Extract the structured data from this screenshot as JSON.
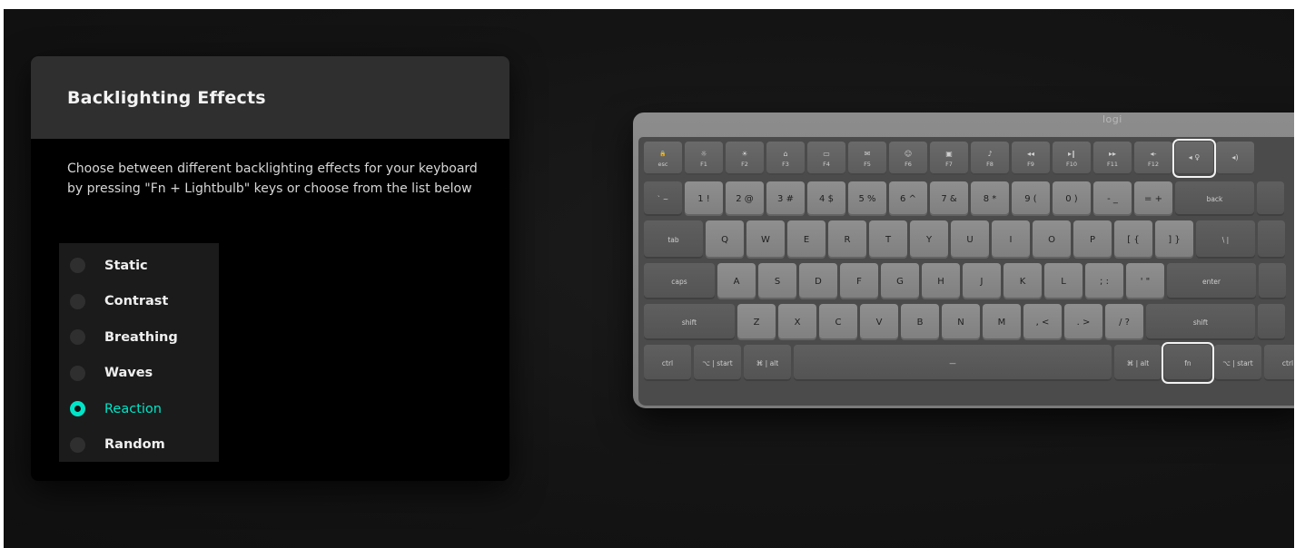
{
  "panel": {
    "title": "Backlighting Effects",
    "description": "Choose between different backlighting effects for your keyboard by pressing \"Fn + Lightbulb\" keys or choose from the list below",
    "selected": "Reaction",
    "options": [
      {
        "label": "Static",
        "selected": false
      },
      {
        "label": "Contrast",
        "selected": false
      },
      {
        "label": "Breathing",
        "selected": false
      },
      {
        "label": "Waves",
        "selected": false
      },
      {
        "label": "Reaction",
        "selected": true
      },
      {
        "label": "Random",
        "selected": false
      }
    ],
    "accent_color": "#00e5c8"
  },
  "keyboard": {
    "brand": "logi",
    "highlighted_keys": [
      "backlight",
      "fn"
    ],
    "rows": [
      [
        {
          "label": "esc",
          "icon": "lock-icon",
          "type": "fn",
          "name": "key-esc"
        },
        {
          "label": "F1",
          "icon": "☼",
          "type": "fn",
          "name": "key-f1"
        },
        {
          "label": "F2",
          "icon": "☀",
          "type": "fn",
          "name": "key-f2"
        },
        {
          "label": "F3",
          "icon": "⌂",
          "type": "fn",
          "name": "key-f3"
        },
        {
          "label": "F4",
          "icon": "▭",
          "type": "fn",
          "name": "key-f4"
        },
        {
          "label": "F5",
          "icon": "✉",
          "type": "fn",
          "name": "key-f5"
        },
        {
          "label": "F6",
          "icon": "☺",
          "type": "fn",
          "name": "key-f6"
        },
        {
          "label": "F7",
          "icon": "▣",
          "type": "fn",
          "name": "key-f7"
        },
        {
          "label": "F8",
          "icon": "♪",
          "type": "fn",
          "name": "key-f8"
        },
        {
          "label": "F9",
          "icon": "◂◂",
          "type": "fn",
          "name": "key-f9"
        },
        {
          "label": "F10",
          "icon": "▸‖",
          "type": "fn",
          "name": "key-f10"
        },
        {
          "label": "F11",
          "icon": "▸▸",
          "type": "fn",
          "name": "key-f11"
        },
        {
          "label": "F12",
          "icon": "◂-",
          "type": "fn",
          "name": "key-f12"
        },
        {
          "label": "",
          "icon": "◂ ♀",
          "type": "fn",
          "name": "key-backlight",
          "selected": true
        },
        {
          "label": "",
          "icon": "◂)",
          "type": "fn",
          "name": "key-volume-up"
        }
      ],
      [
        {
          "label": "` ~",
          "type": "dark",
          "name": "key-backtick"
        },
        {
          "label": "1 !",
          "type": "alpha",
          "name": "key-1"
        },
        {
          "label": "2 @",
          "type": "alpha",
          "name": "key-2"
        },
        {
          "label": "3 #",
          "type": "alpha",
          "name": "key-3"
        },
        {
          "label": "4 $",
          "type": "alpha",
          "name": "key-4"
        },
        {
          "label": "5 %",
          "type": "alpha",
          "name": "key-5"
        },
        {
          "label": "6 ^",
          "type": "alpha",
          "name": "key-6"
        },
        {
          "label": "7 &",
          "type": "alpha",
          "name": "key-7"
        },
        {
          "label": "8 *",
          "type": "alpha",
          "name": "key-8"
        },
        {
          "label": "9 (",
          "type": "alpha",
          "name": "key-9"
        },
        {
          "label": "0 )",
          "type": "alpha",
          "name": "key-0"
        },
        {
          "label": "- _",
          "type": "alpha",
          "name": "key-minus"
        },
        {
          "label": "= +",
          "type": "alpha",
          "name": "key-equals"
        },
        {
          "label": "back",
          "type": "dark",
          "name": "key-backspace"
        },
        {
          "label": "",
          "type": "dark",
          "name": "key-edge"
        }
      ],
      [
        {
          "label": "tab",
          "type": "dark",
          "name": "key-tab"
        },
        {
          "label": "Q",
          "type": "alpha",
          "name": "key-q"
        },
        {
          "label": "W",
          "type": "alpha",
          "name": "key-w"
        },
        {
          "label": "E",
          "type": "alpha",
          "name": "key-e"
        },
        {
          "label": "R",
          "type": "alpha",
          "name": "key-r"
        },
        {
          "label": "T",
          "type": "alpha",
          "name": "key-t"
        },
        {
          "label": "Y",
          "type": "alpha",
          "name": "key-y"
        },
        {
          "label": "U",
          "type": "alpha",
          "name": "key-u"
        },
        {
          "label": "I",
          "type": "alpha",
          "name": "key-i"
        },
        {
          "label": "O",
          "type": "alpha",
          "name": "key-o"
        },
        {
          "label": "P",
          "type": "alpha",
          "name": "key-p"
        },
        {
          "label": "[ {",
          "type": "alpha",
          "name": "key-lbracket"
        },
        {
          "label": "] }",
          "type": "alpha",
          "name": "key-rbracket"
        },
        {
          "label": "\\ |",
          "type": "dark",
          "name": "key-backslash"
        },
        {
          "label": "",
          "type": "dark",
          "name": "key-edge"
        }
      ],
      [
        {
          "label": "caps",
          "type": "dark",
          "name": "key-caps"
        },
        {
          "label": "A",
          "type": "alpha",
          "name": "key-a"
        },
        {
          "label": "S",
          "type": "alpha",
          "name": "key-s"
        },
        {
          "label": "D",
          "type": "alpha",
          "name": "key-d"
        },
        {
          "label": "F",
          "type": "alpha",
          "name": "key-f"
        },
        {
          "label": "G",
          "type": "alpha",
          "name": "key-g"
        },
        {
          "label": "H",
          "type": "alpha",
          "name": "key-h"
        },
        {
          "label": "J",
          "type": "alpha",
          "name": "key-j"
        },
        {
          "label": "K",
          "type": "alpha",
          "name": "key-k"
        },
        {
          "label": "L",
          "type": "alpha",
          "name": "key-l"
        },
        {
          "label": "; :",
          "type": "alpha",
          "name": "key-semicolon"
        },
        {
          "label": "' \"",
          "type": "alpha",
          "name": "key-quote"
        },
        {
          "label": "enter",
          "type": "dark",
          "name": "key-enter"
        },
        {
          "label": "",
          "type": "dark",
          "name": "key-edge"
        }
      ],
      [
        {
          "label": "shift",
          "type": "dark",
          "name": "key-shift-left"
        },
        {
          "label": "Z",
          "type": "alpha",
          "name": "key-z"
        },
        {
          "label": "X",
          "type": "alpha",
          "name": "key-x"
        },
        {
          "label": "C",
          "type": "alpha",
          "name": "key-c"
        },
        {
          "label": "V",
          "type": "alpha",
          "name": "key-v"
        },
        {
          "label": "B",
          "type": "alpha",
          "name": "key-b"
        },
        {
          "label": "N",
          "type": "alpha",
          "name": "key-n"
        },
        {
          "label": "M",
          "type": "alpha",
          "name": "key-m"
        },
        {
          "label": ", <",
          "type": "alpha",
          "name": "key-comma"
        },
        {
          "label": ". >",
          "type": "alpha",
          "name": "key-period"
        },
        {
          "label": "/ ?",
          "type": "alpha",
          "name": "key-slash"
        },
        {
          "label": "shift",
          "type": "dark",
          "name": "key-shift-right"
        },
        {
          "label": "",
          "type": "dark",
          "name": "key-edge"
        }
      ],
      [
        {
          "label": "ctrl",
          "type": "dark",
          "name": "key-ctrl-left"
        },
        {
          "label": "⌥ | start",
          "type": "dark",
          "name": "key-opt-start-left"
        },
        {
          "label": "⌘ | alt",
          "type": "dark",
          "name": "key-cmd-alt-left"
        },
        {
          "label": "—",
          "type": "dark",
          "name": "key-space"
        },
        {
          "label": "⌘ | alt",
          "type": "dark",
          "name": "key-cmd-alt-right"
        },
        {
          "label": "fn",
          "type": "dark",
          "name": "key-fn",
          "selected": true
        },
        {
          "label": "⌥ | start",
          "type": "dark",
          "name": "key-opt-start-right"
        },
        {
          "label": "ctrl",
          "type": "dark",
          "name": "key-ctrl-right"
        },
        {
          "label": "",
          "type": "dark",
          "name": "key-edge"
        }
      ]
    ]
  }
}
